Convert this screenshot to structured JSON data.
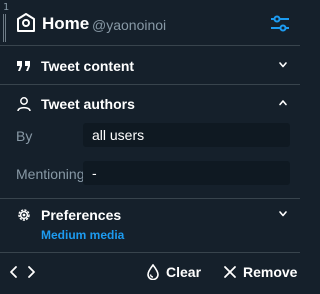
{
  "column": {
    "number": "1"
  },
  "header": {
    "title": "Home",
    "username": "@yaonoinoi",
    "icon": "home-icon",
    "settings_icon": "sliders-icon"
  },
  "sections": {
    "tweet_content": {
      "label": "Tweet content",
      "icon": "quote-icon",
      "expanded": false
    },
    "tweet_authors": {
      "label": "Tweet authors",
      "icon": "user-icon",
      "expanded": true,
      "fields": {
        "by_label": "By",
        "by_value": "all users",
        "mentioning_label": "Mentioning",
        "mentioning_value": "-"
      }
    },
    "preferences": {
      "label": "Preferences",
      "icon": "gear-icon",
      "expanded": false,
      "summary": "Medium media"
    }
  },
  "footer": {
    "prev_icon": "chevron-left-icon",
    "next_icon": "chevron-right-icon",
    "clear_label": "Clear",
    "clear_icon": "drop-icon",
    "remove_label": "Remove",
    "remove_icon": "close-icon"
  },
  "colors": {
    "background": "#15202b",
    "accent": "#1d9bf0",
    "muted": "#8899a6",
    "input_bg": "#0f1922",
    "divider": "#38444d"
  }
}
